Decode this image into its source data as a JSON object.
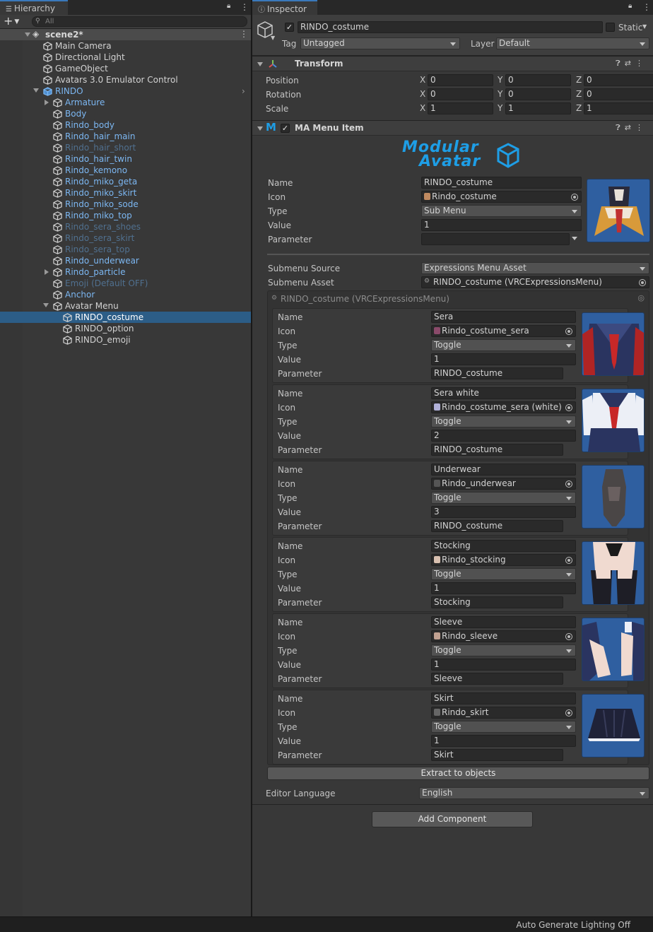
{
  "hierarchy": {
    "tab_label": "Hierarchy",
    "search_placeholder": "All",
    "add_button": "+",
    "scene": "scene2*",
    "items": [
      {
        "label": "Main Camera",
        "indent": 1,
        "style": "norm",
        "fold": "none"
      },
      {
        "label": "Directional Light",
        "indent": 1,
        "style": "norm",
        "fold": "none"
      },
      {
        "label": "GameObject",
        "indent": 1,
        "style": "norm",
        "fold": "none"
      },
      {
        "label": "Avatars 3.0 Emulator Control",
        "indent": 1,
        "style": "norm",
        "fold": "none"
      },
      {
        "label": "RINDO",
        "indent": 1,
        "style": "prefab",
        "fold": "open",
        "arrow": true
      },
      {
        "label": "Armature",
        "indent": 2,
        "style": "prefab",
        "fold": "closed"
      },
      {
        "label": "Body",
        "indent": 2,
        "style": "prefab",
        "fold": "none"
      },
      {
        "label": "Rindo_body",
        "indent": 2,
        "style": "prefab",
        "fold": "none"
      },
      {
        "label": "Rindo_hair_main",
        "indent": 2,
        "style": "prefab",
        "fold": "none"
      },
      {
        "label": "Rindo_hair_short",
        "indent": 2,
        "style": "prefab-dis",
        "fold": "none"
      },
      {
        "label": "Rindo_hair_twin",
        "indent": 2,
        "style": "prefab",
        "fold": "none"
      },
      {
        "label": "Rindo_kemono",
        "indent": 2,
        "style": "prefab",
        "fold": "none"
      },
      {
        "label": "Rindo_miko_geta",
        "indent": 2,
        "style": "prefab",
        "fold": "none"
      },
      {
        "label": "Rindo_miko_skirt",
        "indent": 2,
        "style": "prefab",
        "fold": "none"
      },
      {
        "label": "Rindo_miko_sode",
        "indent": 2,
        "style": "prefab",
        "fold": "none"
      },
      {
        "label": "Rindo_miko_top",
        "indent": 2,
        "style": "prefab",
        "fold": "none"
      },
      {
        "label": "Rindo_sera_shoes",
        "indent": 2,
        "style": "prefab-dis",
        "fold": "none"
      },
      {
        "label": "Rindo_sera_skirt",
        "indent": 2,
        "style": "prefab-dis",
        "fold": "none"
      },
      {
        "label": "Rindo_sera_top",
        "indent": 2,
        "style": "prefab-dis",
        "fold": "none"
      },
      {
        "label": "Rindo_underwear",
        "indent": 2,
        "style": "prefab",
        "fold": "none"
      },
      {
        "label": "Rindo_particle",
        "indent": 2,
        "style": "prefab",
        "fold": "closed"
      },
      {
        "label": "Emoji (Default OFF)",
        "indent": 2,
        "style": "prefab-dis",
        "fold": "none"
      },
      {
        "label": "Anchor",
        "indent": 2,
        "style": "prefab",
        "fold": "none"
      },
      {
        "label": "Avatar Menu",
        "indent": 2,
        "style": "norm",
        "fold": "open"
      },
      {
        "label": "RINDO_costume",
        "indent": 3,
        "style": "sel",
        "fold": "none",
        "selected": true
      },
      {
        "label": "RINDO_option",
        "indent": 3,
        "style": "norm",
        "fold": "none"
      },
      {
        "label": "RINDO_emoji",
        "indent": 3,
        "style": "norm",
        "fold": "none"
      }
    ]
  },
  "inspector": {
    "tab_label": "Inspector",
    "object_name": "RINDO_costume",
    "static_label": "Static",
    "tag_label": "Tag",
    "tag_value": "Untagged",
    "layer_label": "Layer",
    "layer_value": "Default",
    "transform": {
      "title": "Transform",
      "rows": [
        {
          "label": "Position",
          "x": "0",
          "y": "0",
          "z": "0"
        },
        {
          "label": "Rotation",
          "x": "0",
          "y": "0",
          "z": "0"
        },
        {
          "label": "Scale",
          "x": "1",
          "y": "1",
          "z": "1"
        }
      ],
      "axis_x": "X",
      "axis_y": "Y",
      "axis_z": "Z"
    },
    "ma_menu": {
      "title": "MA Menu Item",
      "logo_line1": "Modular",
      "logo_line2": "Avatar",
      "labels": {
        "name": "Name",
        "icon": "Icon",
        "type": "Type",
        "value": "Value",
        "parameter": "Parameter"
      },
      "name": "RINDO_costume",
      "icon": "Rindo_costume",
      "type": "Sub Menu",
      "value": "1",
      "parameter": "",
      "submenu_source_label": "Submenu Source",
      "submenu_source": "Expressions Menu Asset",
      "submenu_asset_label": "Submenu Asset",
      "submenu_asset": "RINDO_costume (VRCExpressionsMenu)",
      "expression_header": "RINDO_costume (VRCExpressionsMenu)",
      "controls": [
        {
          "name": "Sera",
          "icon": "Rindo_costume_sera",
          "type": "Toggle",
          "value": "1",
          "parameter": "RINDO_costume",
          "thumb": "sera",
          "icolor": "#8a4a6a"
        },
        {
          "name": "Sera white",
          "icon": "Rindo_costume_sera (white)",
          "type": "Toggle",
          "value": "2",
          "parameter": "RINDO_costume",
          "thumb": "serawhite",
          "icolor": "#b0b0d8"
        },
        {
          "name": "Underwear",
          "icon": "Rindo_underwear",
          "type": "Toggle",
          "value": "3",
          "parameter": "RINDO_costume",
          "thumb": "underwear",
          "icolor": "#555"
        },
        {
          "name": "Stocking",
          "icon": "Rindo_stocking",
          "type": "Toggle",
          "value": "1",
          "parameter": "Stocking",
          "thumb": "stocking",
          "icolor": "#d8c0b0"
        },
        {
          "name": "Sleeve",
          "icon": "Rindo_sleeve",
          "type": "Toggle",
          "value": "1",
          "parameter": "Sleeve",
          "thumb": "sleeve",
          "icolor": "#c0a090"
        },
        {
          "name": "Skirt",
          "icon": "Rindo_skirt",
          "type": "Toggle",
          "value": "1",
          "parameter": "Skirt",
          "thumb": "skirt",
          "icolor": "#666"
        }
      ],
      "extract_button": "Extract to objects",
      "editor_language_label": "Editor Language",
      "editor_language": "English"
    },
    "add_component": "Add Component"
  },
  "status_bar": {
    "text": "Auto Generate Lighting Off"
  },
  "colors": {
    "accent": "#3a79bb",
    "selection": "#2c5d87",
    "prefab": "#7cb7f2",
    "logo": "#1e9ee6"
  }
}
